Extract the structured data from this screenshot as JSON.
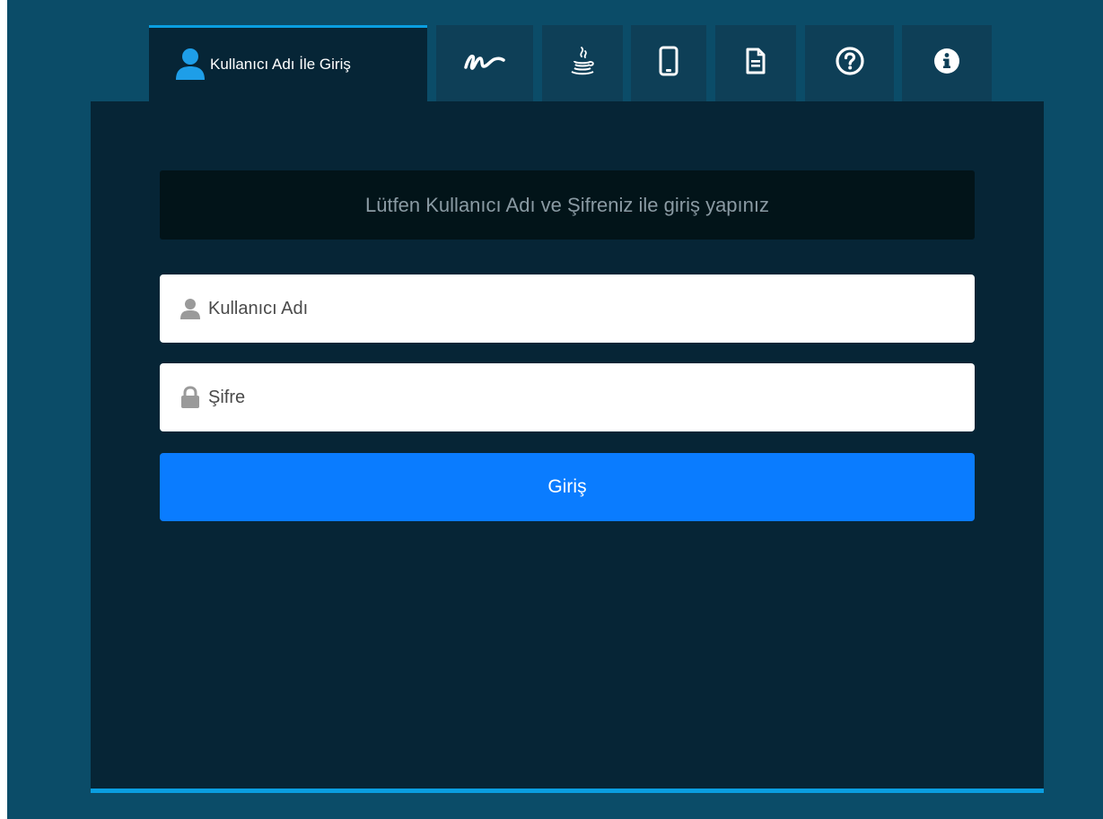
{
  "tabs": [
    {
      "label": "Kullanıcı Adı İle Giriş",
      "icon": "user-icon",
      "active": true
    },
    {
      "label": "",
      "icon": "signature-icon",
      "active": false
    },
    {
      "label": "",
      "icon": "java-icon",
      "active": false
    },
    {
      "label": "",
      "icon": "mobile-icon",
      "active": false
    },
    {
      "label": "",
      "icon": "document-icon",
      "active": false
    },
    {
      "label": "",
      "icon": "help-icon",
      "active": false
    },
    {
      "label": "",
      "icon": "info-icon",
      "active": false
    }
  ],
  "login": {
    "notice": "Lütfen Kullanıcı Adı ve Şifreniz ile giriş yapınız",
    "username_placeholder": "Kullanıcı Adı",
    "username_value": "",
    "password_placeholder": "Şifre",
    "password_value": "",
    "submit_label": "Giriş"
  },
  "colors": {
    "background": "#0b4c68",
    "panel": "#062536",
    "tab": "#0e3f57",
    "accent_line": "#0a9ee0",
    "primary_button": "#0a7cff",
    "active_tab_icon": "#1e9ee8"
  }
}
